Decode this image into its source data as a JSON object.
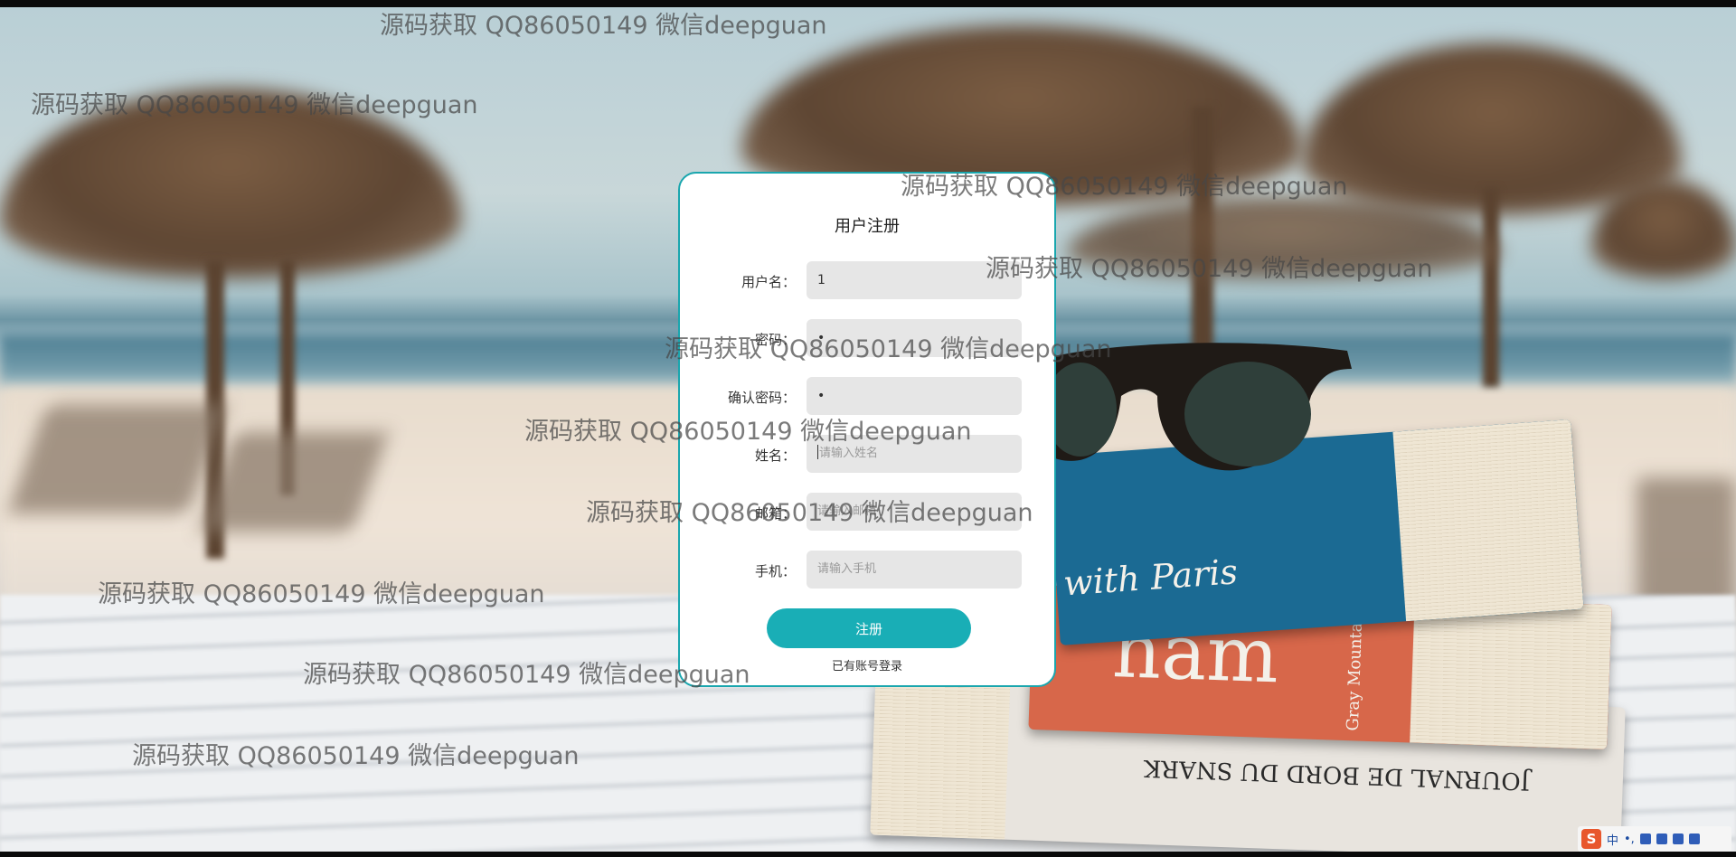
{
  "form": {
    "title": "用户注册",
    "fields": [
      {
        "label": "用户名：",
        "value": "1",
        "placeholder": ""
      },
      {
        "label": "密码：",
        "value": "•",
        "placeholder": ""
      },
      {
        "label": "确认密码：",
        "value": "•",
        "placeholder": ""
      },
      {
        "label": "姓名：",
        "value": "",
        "placeholder": "请输入姓名"
      },
      {
        "label": "邮箱：",
        "value": "",
        "placeholder": "请输入邮箱"
      },
      {
        "label": "手机：",
        "value": "",
        "placeholder": "请输入手机"
      }
    ],
    "submit_label": "注册",
    "login_link": "已有账号登录"
  },
  "watermark": {
    "text": "源码获取 QQ86050149 微信deepguan"
  },
  "background": {
    "book_texts": [
      "with Paris",
      "ham",
      "Gray Mountain",
      "JOURNAL DE BORD DU SNARK"
    ]
  },
  "ime": {
    "logo": "S",
    "mode": "中",
    "punct": "•,",
    "icons": [
      "mic-icon",
      "keyboard-icon",
      "shirt-icon",
      "grid-icon"
    ]
  },
  "colors": {
    "accent": "#19aeb6",
    "card_border": "#1aa6ae",
    "field_bg": "#e6e6e6"
  }
}
